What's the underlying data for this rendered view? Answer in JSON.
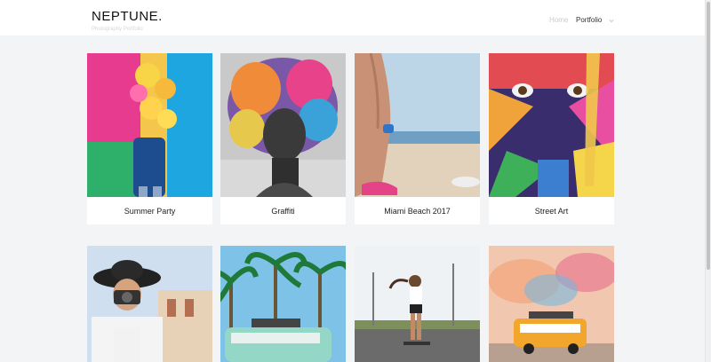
{
  "header": {
    "brand_title": "NEPTUNE.",
    "brand_subtitle": "Photography Portfolio",
    "nav": [
      {
        "label": "Home"
      },
      {
        "label": "Portfolio"
      }
    ],
    "nav_dropdown_icon": "chevron-down-icon"
  },
  "gallery": {
    "row1": [
      {
        "caption": "Summer Party"
      },
      {
        "caption": "Graffiti"
      },
      {
        "caption": "Miami Beach 2017"
      },
      {
        "caption": "Street Art"
      }
    ]
  },
  "colors": {
    "background": "#f3f4f6",
    "card": "#ffffff",
    "text": "#222222",
    "nav_muted": "#c9c9c9"
  }
}
